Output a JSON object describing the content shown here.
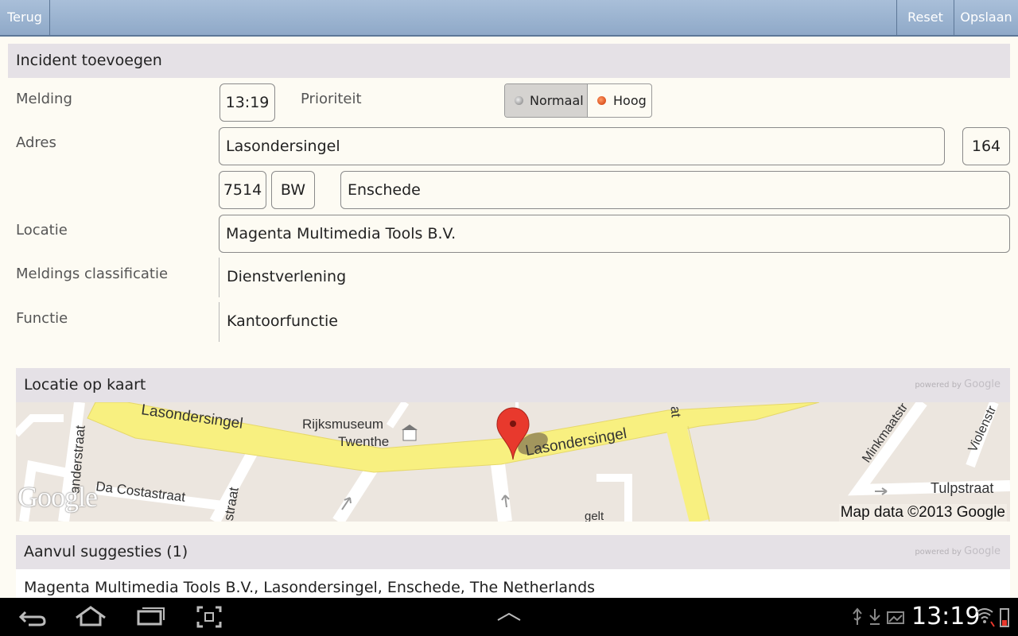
{
  "actionbar": {
    "back_label": "Terug",
    "reset_label": "Reset",
    "save_label": "Opslaan"
  },
  "incident": {
    "title": "Incident toevoegen",
    "melding_label": "Melding",
    "melding_time": "13:19",
    "prioriteit_label": "Prioriteit",
    "priority_options": [
      "Normaal",
      "Hoog"
    ],
    "priority_selected": "Normaal",
    "adres_label": "Adres",
    "street": "Lasondersingel",
    "house_number": "164",
    "postcode_digits": "7514",
    "postcode_letters": "BW",
    "city": "Enschede",
    "locatie_label": "Locatie",
    "locatie": "Magenta Multimedia Tools B.V.",
    "classificatie_label": "Meldings classificatie",
    "classificatie": "Dienstverlening",
    "functie_label": "Functie",
    "functie": "Kantoorfunctie"
  },
  "map_section": {
    "title": "Locatie op kaart",
    "powered_by": "powered by",
    "powered_brand": "Google",
    "logo": "Google",
    "attribution": "Map data ©2013 Google",
    "labels": {
      "lasondersingel_1": "Lasondersingel",
      "lasondersingel_2": "Lasondersingel",
      "rijksmuseum_1": "Rijksmuseum",
      "rijksmuseum_2": "Twenthe",
      "anderstraat": "anderstraat",
      "da_costastraat": "Da Costastraat",
      "straat_vertical": "straat",
      "minkmaatstr": "Minkmaatstr",
      "violenstr": "Violenstr",
      "tulpstraat": "Tulpstraat",
      "gelt": "gelt",
      "at": "at"
    }
  },
  "suggestions": {
    "title": "Aanvul suggesties (1)",
    "powered_by": "powered by",
    "powered_brand": "Google",
    "items": [
      "Magenta Multimedia Tools B.V., Lasondersingel, Enschede, The Netherlands"
    ]
  },
  "statusbar": {
    "time": "13:19"
  },
  "colors": {
    "actionbar": "#9bb3d0",
    "header": "#e5e1e6",
    "road_main": "#f8f080",
    "map_bg": "#ece6df",
    "marker": "#e8392d"
  }
}
